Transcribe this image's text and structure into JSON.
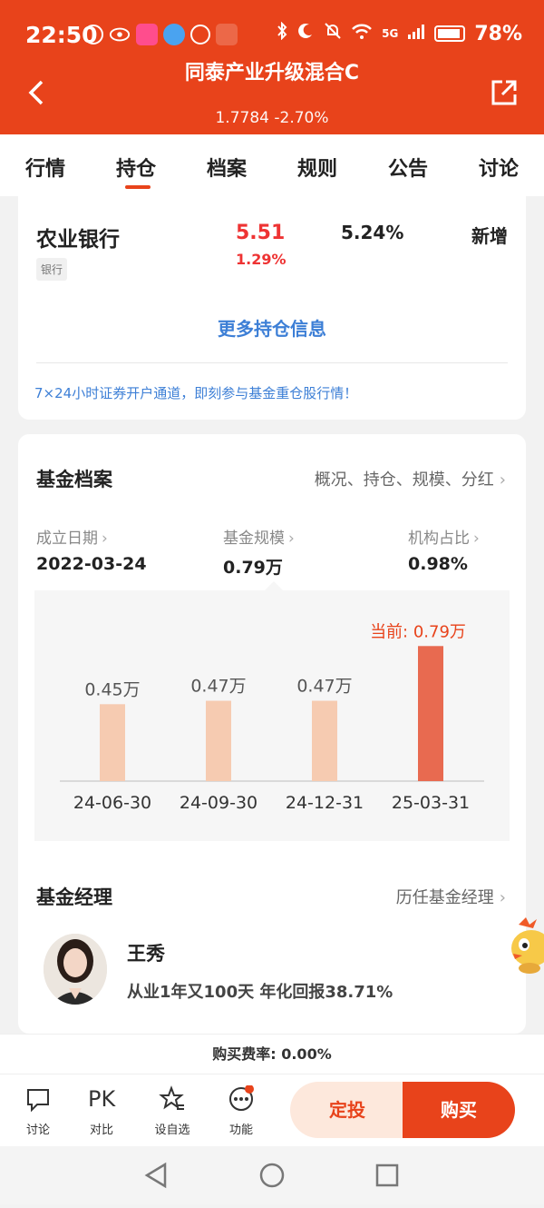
{
  "status_bar": {
    "time": "22:50",
    "battery": "78%",
    "network": "5G"
  },
  "header": {
    "title": "同泰产业升级混合C",
    "nav_value": "1.7784 -2.70%"
  },
  "tabs": [
    "行情",
    "持仓",
    "档案",
    "规则",
    "公告",
    "讨论"
  ],
  "active_tab": "持仓",
  "holding": {
    "stock_name": "农业银行",
    "tag": "银行",
    "price": "5.51",
    "change": "1.29%",
    "ratio": "5.24%",
    "status": "新增",
    "more_link": "更多持仓信息",
    "promo": "7×24小时证券开户通道，即刻参与基金重仓股行情！"
  },
  "fund_profile": {
    "title": "基金档案",
    "link": "概况、持仓、规模、分红",
    "items": [
      {
        "label": "成立日期",
        "value": "2022-03-24"
      },
      {
        "label": "基金规模",
        "value": "0.79万"
      },
      {
        "label": "机构占比",
        "value": "0.98%"
      }
    ]
  },
  "chart_data": {
    "type": "bar",
    "categories": [
      "24-06-30",
      "24-09-30",
      "24-12-31",
      "25-03-31"
    ],
    "values": [
      0.45,
      0.47,
      0.47,
      0.79
    ],
    "value_labels": [
      "0.45万",
      "0.47万",
      "0.47万",
      "当前: 0.79万"
    ],
    "title": "",
    "xlabel": "",
    "ylabel": "",
    "ylim": [
      0,
      0.85
    ],
    "colors": {
      "normal": "#f6cbb1",
      "current": "#e86a50"
    }
  },
  "manager": {
    "title": "基金经理",
    "link": "历任基金经理",
    "name": "王秀",
    "desc": "从业1年又100天 年化回报38.71%"
  },
  "fee": "购买费率: 0.00%",
  "bottom_bar": {
    "items": [
      "讨论",
      "对比",
      "设自选",
      "功能"
    ],
    "pk_label": "PK",
    "auto_invest": "定投",
    "buy": "购买"
  },
  "colors": {
    "brand": "#e8431b",
    "up": "#e33333",
    "link": "#3d7fd6"
  }
}
